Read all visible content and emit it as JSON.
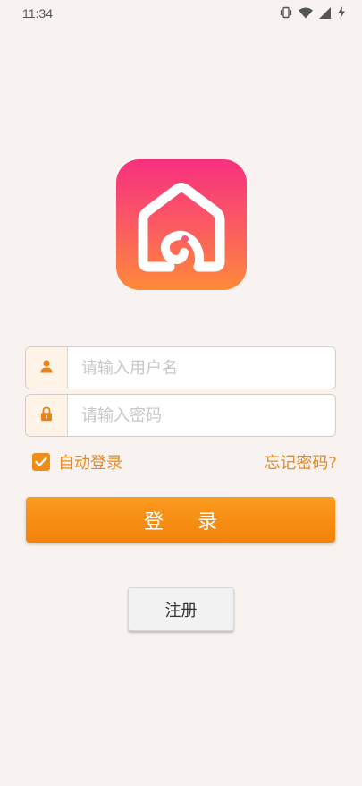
{
  "status_bar": {
    "time": "11:34"
  },
  "colors": {
    "accent": "#f08c17",
    "accent_text": "#e88a21",
    "logo_gradient_top": "#f7307f",
    "logo_gradient_bottom": "#fe8a3a",
    "background": "#f8f3f1"
  },
  "icons": {
    "logo": "house-logo-icon",
    "username": "user-icon",
    "password": "lock-icon",
    "checkbox": "checkmark-icon"
  },
  "login_form": {
    "username_placeholder": "请输入用户名",
    "username_value": "",
    "password_placeholder": "请输入密码",
    "password_value": "",
    "auto_login_label": "自动登录",
    "auto_login_checked": true,
    "forgot_password_label": "忘记密码?",
    "login_label": "登录",
    "register_label": "注册"
  }
}
